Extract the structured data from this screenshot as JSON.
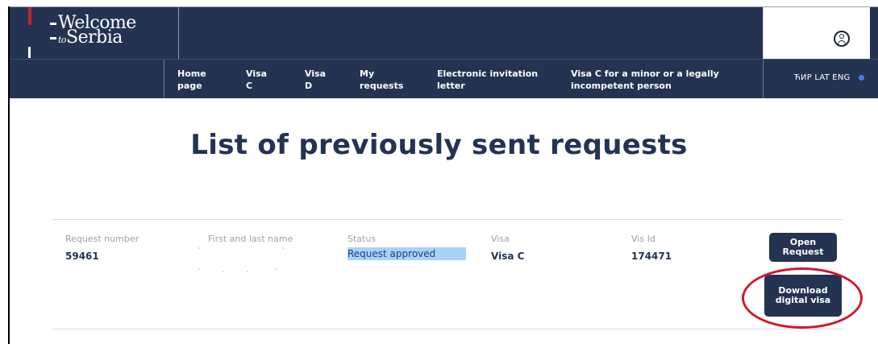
{
  "header": {
    "logo_line1": "Welcome",
    "logo_to": "to",
    "logo_line2": "Serbia"
  },
  "nav": {
    "items": [
      {
        "line1": "Home",
        "line2": "page"
      },
      {
        "line1": "Visa",
        "line2": "C"
      },
      {
        "line1": "Visa",
        "line2": "D"
      },
      {
        "line1": "My",
        "line2": "requests"
      },
      {
        "line1": "Electronic invitation",
        "line2": "letter"
      },
      {
        "line1": "Visa C for a minor or a legally",
        "line2": "incompetent person"
      }
    ],
    "languages": "ЋИР LAT ENG"
  },
  "page": {
    "title": "List of previously sent requests"
  },
  "requests": {
    "columns": {
      "request_number": "Request number",
      "name": "First and last name",
      "status": "Status",
      "visa": "Visa",
      "vis_id": "Vis Id"
    },
    "rows": [
      {
        "request_number": "59461",
        "status": "Request approved",
        "visa": "Visa C",
        "vis_id": "174471",
        "open_button": "Open Request",
        "download_button": "Download digital visa"
      }
    ]
  },
  "colors": {
    "navy": "#243352",
    "highlight": "#a9d3f4",
    "annotation": "#d0182a"
  }
}
